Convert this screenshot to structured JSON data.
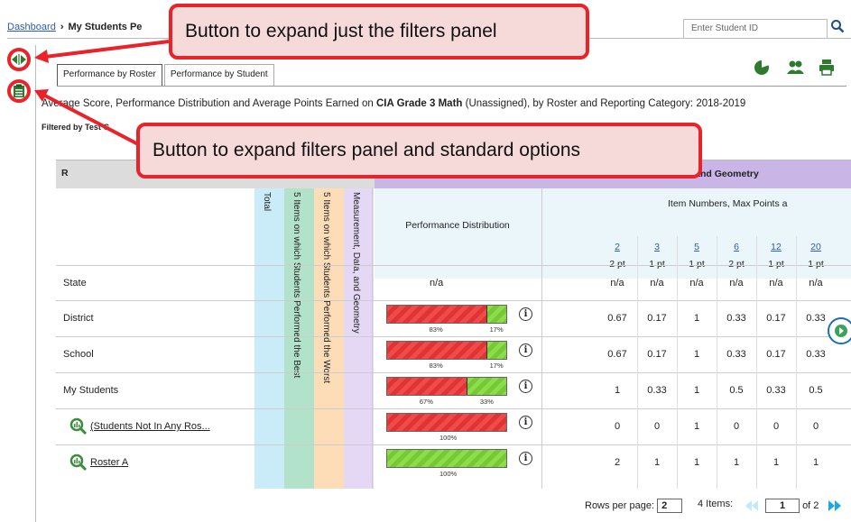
{
  "breadcrumb": {
    "home": "Dashboard",
    "current": "My Students Pe"
  },
  "search": {
    "placeholder": "Enter Student ID"
  },
  "tabs": [
    {
      "label": "Performance by Roster",
      "active": true
    },
    {
      "label": "Performance by Student",
      "active": false
    }
  ],
  "report": {
    "title_pre": "Average Score, Performance Distribution and Average Points Earned on ",
    "title_bold": "CIA Grade 3 Math",
    "title_post": " (Unassigned), by Roster and Reporting Category: 2018-2019",
    "filtered_by": "Filtered by Test G"
  },
  "table": {
    "header_first": "R",
    "reporting_category": "ent, Data, and Geometry",
    "item_numbers_header": "Item Numbers, Max Points a",
    "performance_distribution": "Performance Distribution",
    "col_total": "Total",
    "col_best": "5 Items on which Students Performed the Best",
    "col_worst": "5 Items on which Students Performed the Worst",
    "col_mdg": "Measurement, Data, and Geometry",
    "items": [
      {
        "num": "2",
        "pts": "2 pt"
      },
      {
        "num": "3",
        "pts": "1 pt"
      },
      {
        "num": "5",
        "pts": "1 pt"
      },
      {
        "num": "6",
        "pts": "2 pt"
      },
      {
        "num": "12",
        "pts": "1 pt"
      },
      {
        "num": "20",
        "pts": "1 pt"
      }
    ],
    "rows": [
      {
        "label": "State",
        "dist_na": "n/a",
        "values": [
          "n/a",
          "n/a",
          "n/a",
          "n/a",
          "n/a",
          "n/a"
        ]
      },
      {
        "label": "District",
        "red": 83,
        "green": 17,
        "red_label": "83%",
        "green_label": "17%",
        "values": [
          "0.67",
          "0.17",
          "1",
          "0.33",
          "0.17",
          "0.33"
        ]
      },
      {
        "label": "School",
        "red": 83,
        "green": 17,
        "red_label": "83%",
        "green_label": "17%",
        "values": [
          "0.67",
          "0.17",
          "1",
          "0.33",
          "0.17",
          "0.33"
        ]
      },
      {
        "label": "My Students",
        "red": 67,
        "green": 33,
        "red_label": "67%",
        "green_label": "33%",
        "values": [
          "1",
          "0.33",
          "1",
          "0.5",
          "0.33",
          "0.5"
        ]
      },
      {
        "label": "(Students Not In Any Ros...",
        "red": 100,
        "green": 0,
        "red_label": "100%",
        "values": [
          "0",
          "0",
          "1",
          "0",
          "0",
          "0"
        ]
      },
      {
        "label": "Roster A",
        "red": 0,
        "green": 100,
        "green_label": "100%",
        "values": [
          "2",
          "1",
          "1",
          "1",
          "1",
          "1"
        ]
      }
    ]
  },
  "pager": {
    "rows_label": "Rows per page:",
    "rows_value": "2",
    "items_label": "4 Items:",
    "page": "1",
    "of": "of 2"
  },
  "callouts": {
    "filters_only": "Button to expand just the filters panel",
    "filters_and_options": "Button to expand filters panel and standard options"
  },
  "info_glyph": "i",
  "colors": {
    "callout_border": "#e8232a",
    "callout_fill": "#f6d9d9",
    "bar_red": "#f04b4b",
    "bar_green": "#8ddc4b",
    "purple_header": "#c9b5e6"
  }
}
